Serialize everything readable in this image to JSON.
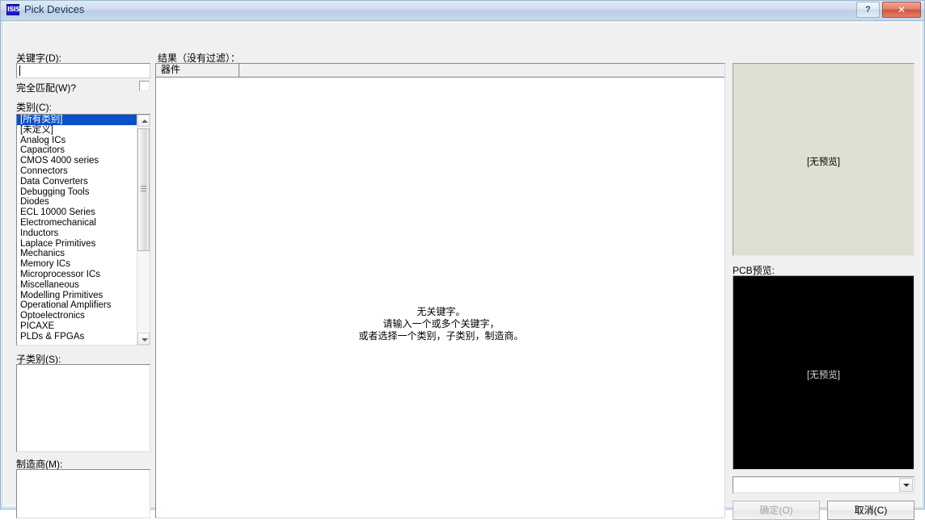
{
  "window": {
    "title": "Pick Devices",
    "icon": "isis-app-icon",
    "icon_text": "ISIS",
    "help_button": "?",
    "close_button": "✕"
  },
  "left_panel": {
    "keyword_label": "关键字(D):",
    "keyword_value": "",
    "keyword_placeholder": "",
    "match_whole_label": "完全匹配(W)?",
    "match_whole_checked": false,
    "category_label": "类别(C):",
    "categories": [
      "[所有类别]",
      "[未定义]",
      "Analog ICs",
      "Capacitors",
      "CMOS 4000 series",
      "Connectors",
      "Data Converters",
      "Debugging Tools",
      "Diodes",
      "ECL 10000 Series",
      "Electromechanical",
      "Inductors",
      "Laplace Primitives",
      "Mechanics",
      "Memory ICs",
      "Microprocessor ICs",
      "Miscellaneous",
      "Modelling Primitives",
      "Operational Amplifiers",
      "Optoelectronics",
      "PICAXE",
      "PLDs & FPGAs"
    ],
    "selected_category": "[所有类别]",
    "subcategory_label": "子类别(S):",
    "subcategories": [],
    "manufacturer_label": "制造商(M):",
    "manufacturers": []
  },
  "results": {
    "title": "结果（没有过滤）：",
    "columns": [
      "器件",
      ""
    ],
    "rows": [],
    "empty_message_lines": [
      "无关键字。",
      "请输入一个或多个关键字，",
      "或者选择一个类别，子类别，制造商。"
    ]
  },
  "preview": {
    "schematic_text": "[无预览]",
    "pcb_label": "PCB预览:",
    "pcb_text": "[无预览]",
    "footprint_value": "",
    "footprint_options": []
  },
  "footer": {
    "ok_label": "确定(O)",
    "ok_enabled": false,
    "cancel_label": "取消(C)"
  },
  "colors": {
    "selection": "#0a50c8",
    "title_bar": "#cfddef",
    "close_button": "#d1543c",
    "schematic_bg": "#dfdfd2",
    "pcb_bg": "#000000"
  }
}
